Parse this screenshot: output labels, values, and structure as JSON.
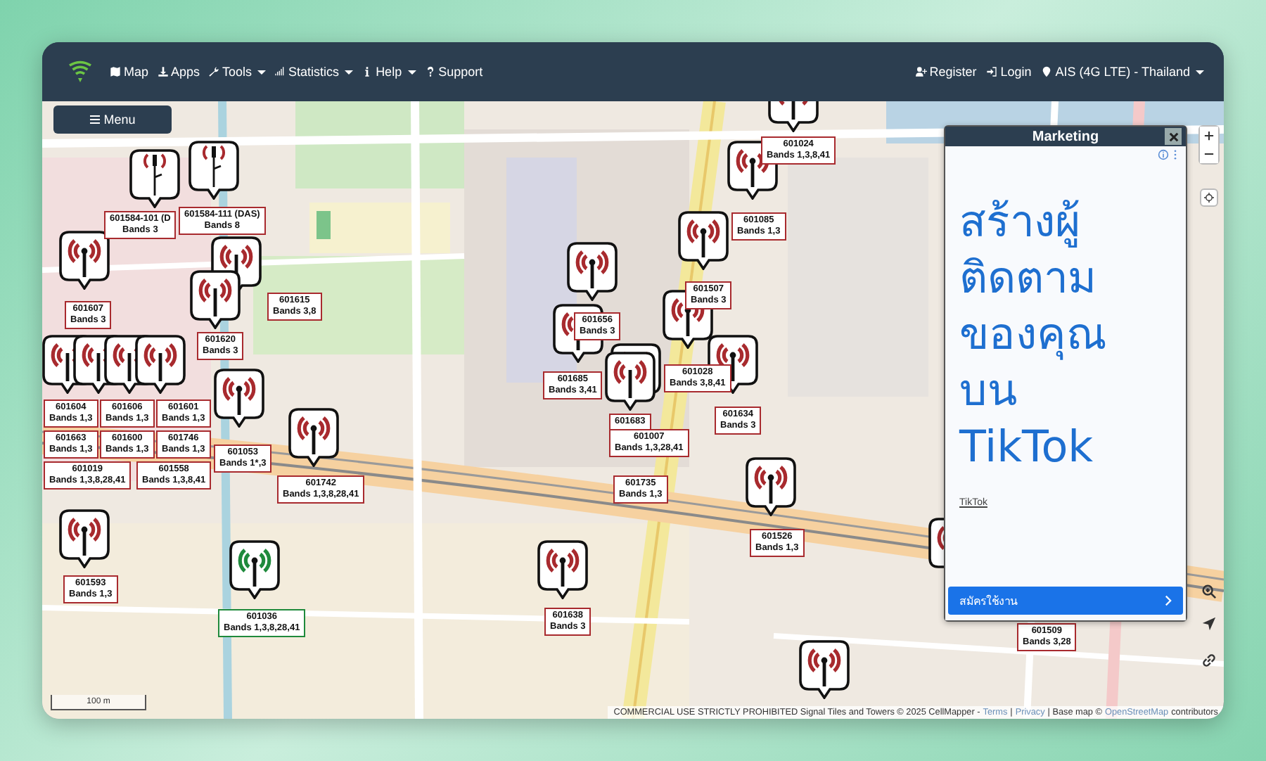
{
  "navbar": {
    "left": [
      {
        "kind": "map",
        "label": "Map",
        "dropdown": false
      },
      {
        "kind": "download",
        "label": "Apps",
        "dropdown": false
      },
      {
        "kind": "wrench",
        "label": "Tools",
        "dropdown": true
      },
      {
        "kind": "bars",
        "label": "Statistics",
        "dropdown": true
      },
      {
        "kind": "info",
        "label": "Help",
        "dropdown": true
      },
      {
        "kind": "question",
        "label": "Support",
        "dropdown": false
      }
    ],
    "right": [
      {
        "kind": "user-plus",
        "label": "Register",
        "dropdown": false
      },
      {
        "kind": "sign-in",
        "label": "Login",
        "dropdown": false
      },
      {
        "kind": "pin",
        "label": "AIS (4G LTE) - Thailand",
        "dropdown": true
      }
    ]
  },
  "menu_button": "Menu",
  "towers": [
    {
      "kind": "das",
      "color": "#a82a2e",
      "id": "601584-101 (D",
      "bands": "Bands 3"
    },
    {
      "kind": "das",
      "color": "#a82a2e",
      "id": "601584-111 (DAS)",
      "bands": "Bands 8"
    },
    {
      "kind": "tower",
      "color": "#a82a2e",
      "id": "601607",
      "bands": "Bands 3"
    },
    {
      "color": "#a82a2e",
      "id": "601615",
      "bands": "Bands 3,8"
    },
    {
      "color": "#a82a2e",
      "id": "601620",
      "bands": "Bands 3"
    },
    {
      "color": "#a82a2e",
      "id": "601604",
      "bands": "Bands 1,3"
    },
    {
      "color": "#a82a2e",
      "id": "601606",
      "bands": "Bands 1,3"
    },
    {
      "color": "#a82a2e",
      "id": "601663",
      "bands": "Bands 1,3"
    },
    {
      "color": "#a82a2e",
      "id": "601600",
      "bands": "Bands 1,3"
    },
    {
      "color": "#a82a2e",
      "id": "601601",
      "bands": "Bands 1,3"
    },
    {
      "color": "#a82a2e",
      "id": "601746",
      "bands": "Bands 1,3"
    },
    {
      "color": "#a82a2e",
      "id": "601019",
      "bands": "Bands 1,3,8,28,41"
    },
    {
      "color": "#a82a2e",
      "id": "601558",
      "bands": "Bands 1,3,8,41"
    },
    {
      "kind": "tower",
      "color": "#a82a2e",
      "id": "601053",
      "bands": "Bands 1*,3"
    },
    {
      "kind": "tower",
      "color": "#a82a2e",
      "id": "601742",
      "bands": "Bands 1,3,8,28,41"
    },
    {
      "kind": "tower",
      "color": "#a82a2e",
      "id": "601593",
      "bands": "Bands 1,3"
    },
    {
      "kind": "tower",
      "color": "#1f8a3c",
      "id": "601036",
      "bands": "Bands 1,3,8,28,41"
    },
    {
      "kind": "tower",
      "color": "#a82a2e",
      "id": "601638",
      "bands": "Bands 3"
    },
    {
      "kind": "tower",
      "color": "#a82a2e",
      "id": "601024",
      "bands": "Bands 1,3,8,41"
    },
    {
      "kind": "tower",
      "color": "#a82a2e",
      "id": "601085",
      "bands": "Bands 1,3"
    },
    {
      "kind": "tower",
      "color": "#a82a2e",
      "id": "601507",
      "bands": "Bands 3"
    },
    {
      "kind": "tower",
      "color": "#a82a2e",
      "id": "601656",
      "bands": "Bands 3"
    },
    {
      "kind": "tower",
      "color": "#a82a2e",
      "id": "601685",
      "bands": "Bands 3,41"
    },
    {
      "kind": "tower",
      "color": "#a82a2e",
      "id": "601028",
      "bands": "Bands 3,8,41"
    },
    {
      "color": "#a82a2e",
      "id": "601683"
    },
    {
      "color": "#a82a2e",
      "id": "601007",
      "bands": "Bands 1,3,28,41"
    },
    {
      "color": "#a82a2e",
      "id": "601735",
      "bands": "Bands 1,3"
    },
    {
      "kind": "tower",
      "color": "#a82a2e",
      "id": "601634",
      "bands": "Bands 3"
    },
    {
      "kind": "tower",
      "color": "#a82a2e",
      "id": "601526",
      "bands": "Bands 1,3"
    },
    {
      "kind": "tower",
      "color": "#a82a2e",
      "id": "601509",
      "bands": "Bands 3,28"
    },
    {
      "kind": "tower",
      "color": "#a82a2e"
    }
  ],
  "marketing_panel": {
    "title": "Marketing",
    "headline_lines": [
      "สร้างผู้",
      "ติดตาม",
      "ของคุณ",
      "บน",
      "TikTok"
    ],
    "advertiser": "TikTok",
    "cta": "สมัครใช้งาน"
  },
  "scale": "100 m",
  "attribution": {
    "text": "COMMERCIAL USE STRICTLY PROHIBITED Signal Tiles and Towers © 2025 CellMapper -",
    "terms": "Terms",
    "sep1": "|",
    "privacy": "Privacy",
    "sep2": "| Base map ©",
    "osm": "OpenStreetMap",
    "tail": "contributors"
  }
}
